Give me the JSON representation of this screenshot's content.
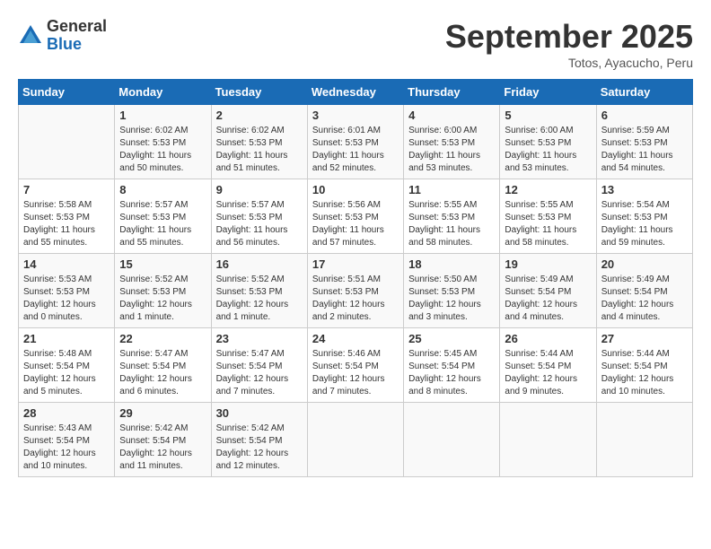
{
  "header": {
    "logo_general": "General",
    "logo_blue": "Blue",
    "month_title": "September 2025",
    "subtitle": "Totos, Ayacucho, Peru"
  },
  "days_of_week": [
    "Sunday",
    "Monday",
    "Tuesday",
    "Wednesday",
    "Thursday",
    "Friday",
    "Saturday"
  ],
  "weeks": [
    [
      {
        "day": "",
        "info": ""
      },
      {
        "day": "1",
        "info": "Sunrise: 6:02 AM\nSunset: 5:53 PM\nDaylight: 11 hours\nand 50 minutes."
      },
      {
        "day": "2",
        "info": "Sunrise: 6:02 AM\nSunset: 5:53 PM\nDaylight: 11 hours\nand 51 minutes."
      },
      {
        "day": "3",
        "info": "Sunrise: 6:01 AM\nSunset: 5:53 PM\nDaylight: 11 hours\nand 52 minutes."
      },
      {
        "day": "4",
        "info": "Sunrise: 6:00 AM\nSunset: 5:53 PM\nDaylight: 11 hours\nand 53 minutes."
      },
      {
        "day": "5",
        "info": "Sunrise: 6:00 AM\nSunset: 5:53 PM\nDaylight: 11 hours\nand 53 minutes."
      },
      {
        "day": "6",
        "info": "Sunrise: 5:59 AM\nSunset: 5:53 PM\nDaylight: 11 hours\nand 54 minutes."
      }
    ],
    [
      {
        "day": "7",
        "info": "Sunrise: 5:58 AM\nSunset: 5:53 PM\nDaylight: 11 hours\nand 55 minutes."
      },
      {
        "day": "8",
        "info": "Sunrise: 5:57 AM\nSunset: 5:53 PM\nDaylight: 11 hours\nand 55 minutes."
      },
      {
        "day": "9",
        "info": "Sunrise: 5:57 AM\nSunset: 5:53 PM\nDaylight: 11 hours\nand 56 minutes."
      },
      {
        "day": "10",
        "info": "Sunrise: 5:56 AM\nSunset: 5:53 PM\nDaylight: 11 hours\nand 57 minutes."
      },
      {
        "day": "11",
        "info": "Sunrise: 5:55 AM\nSunset: 5:53 PM\nDaylight: 11 hours\nand 58 minutes."
      },
      {
        "day": "12",
        "info": "Sunrise: 5:55 AM\nSunset: 5:53 PM\nDaylight: 11 hours\nand 58 minutes."
      },
      {
        "day": "13",
        "info": "Sunrise: 5:54 AM\nSunset: 5:53 PM\nDaylight: 11 hours\nand 59 minutes."
      }
    ],
    [
      {
        "day": "14",
        "info": "Sunrise: 5:53 AM\nSunset: 5:53 PM\nDaylight: 12 hours\nand 0 minutes."
      },
      {
        "day": "15",
        "info": "Sunrise: 5:52 AM\nSunset: 5:53 PM\nDaylight: 12 hours\nand 1 minute."
      },
      {
        "day": "16",
        "info": "Sunrise: 5:52 AM\nSunset: 5:53 PM\nDaylight: 12 hours\nand 1 minute."
      },
      {
        "day": "17",
        "info": "Sunrise: 5:51 AM\nSunset: 5:53 PM\nDaylight: 12 hours\nand 2 minutes."
      },
      {
        "day": "18",
        "info": "Sunrise: 5:50 AM\nSunset: 5:53 PM\nDaylight: 12 hours\nand 3 minutes."
      },
      {
        "day": "19",
        "info": "Sunrise: 5:49 AM\nSunset: 5:54 PM\nDaylight: 12 hours\nand 4 minutes."
      },
      {
        "day": "20",
        "info": "Sunrise: 5:49 AM\nSunset: 5:54 PM\nDaylight: 12 hours\nand 4 minutes."
      }
    ],
    [
      {
        "day": "21",
        "info": "Sunrise: 5:48 AM\nSunset: 5:54 PM\nDaylight: 12 hours\nand 5 minutes."
      },
      {
        "day": "22",
        "info": "Sunrise: 5:47 AM\nSunset: 5:54 PM\nDaylight: 12 hours\nand 6 minutes."
      },
      {
        "day": "23",
        "info": "Sunrise: 5:47 AM\nSunset: 5:54 PM\nDaylight: 12 hours\nand 7 minutes."
      },
      {
        "day": "24",
        "info": "Sunrise: 5:46 AM\nSunset: 5:54 PM\nDaylight: 12 hours\nand 7 minutes."
      },
      {
        "day": "25",
        "info": "Sunrise: 5:45 AM\nSunset: 5:54 PM\nDaylight: 12 hours\nand 8 minutes."
      },
      {
        "day": "26",
        "info": "Sunrise: 5:44 AM\nSunset: 5:54 PM\nDaylight: 12 hours\nand 9 minutes."
      },
      {
        "day": "27",
        "info": "Sunrise: 5:44 AM\nSunset: 5:54 PM\nDaylight: 12 hours\nand 10 minutes."
      }
    ],
    [
      {
        "day": "28",
        "info": "Sunrise: 5:43 AM\nSunset: 5:54 PM\nDaylight: 12 hours\nand 10 minutes."
      },
      {
        "day": "29",
        "info": "Sunrise: 5:42 AM\nSunset: 5:54 PM\nDaylight: 12 hours\nand 11 minutes."
      },
      {
        "day": "30",
        "info": "Sunrise: 5:42 AM\nSunset: 5:54 PM\nDaylight: 12 hours\nand 12 minutes."
      },
      {
        "day": "",
        "info": ""
      },
      {
        "day": "",
        "info": ""
      },
      {
        "day": "",
        "info": ""
      },
      {
        "day": "",
        "info": ""
      }
    ]
  ]
}
